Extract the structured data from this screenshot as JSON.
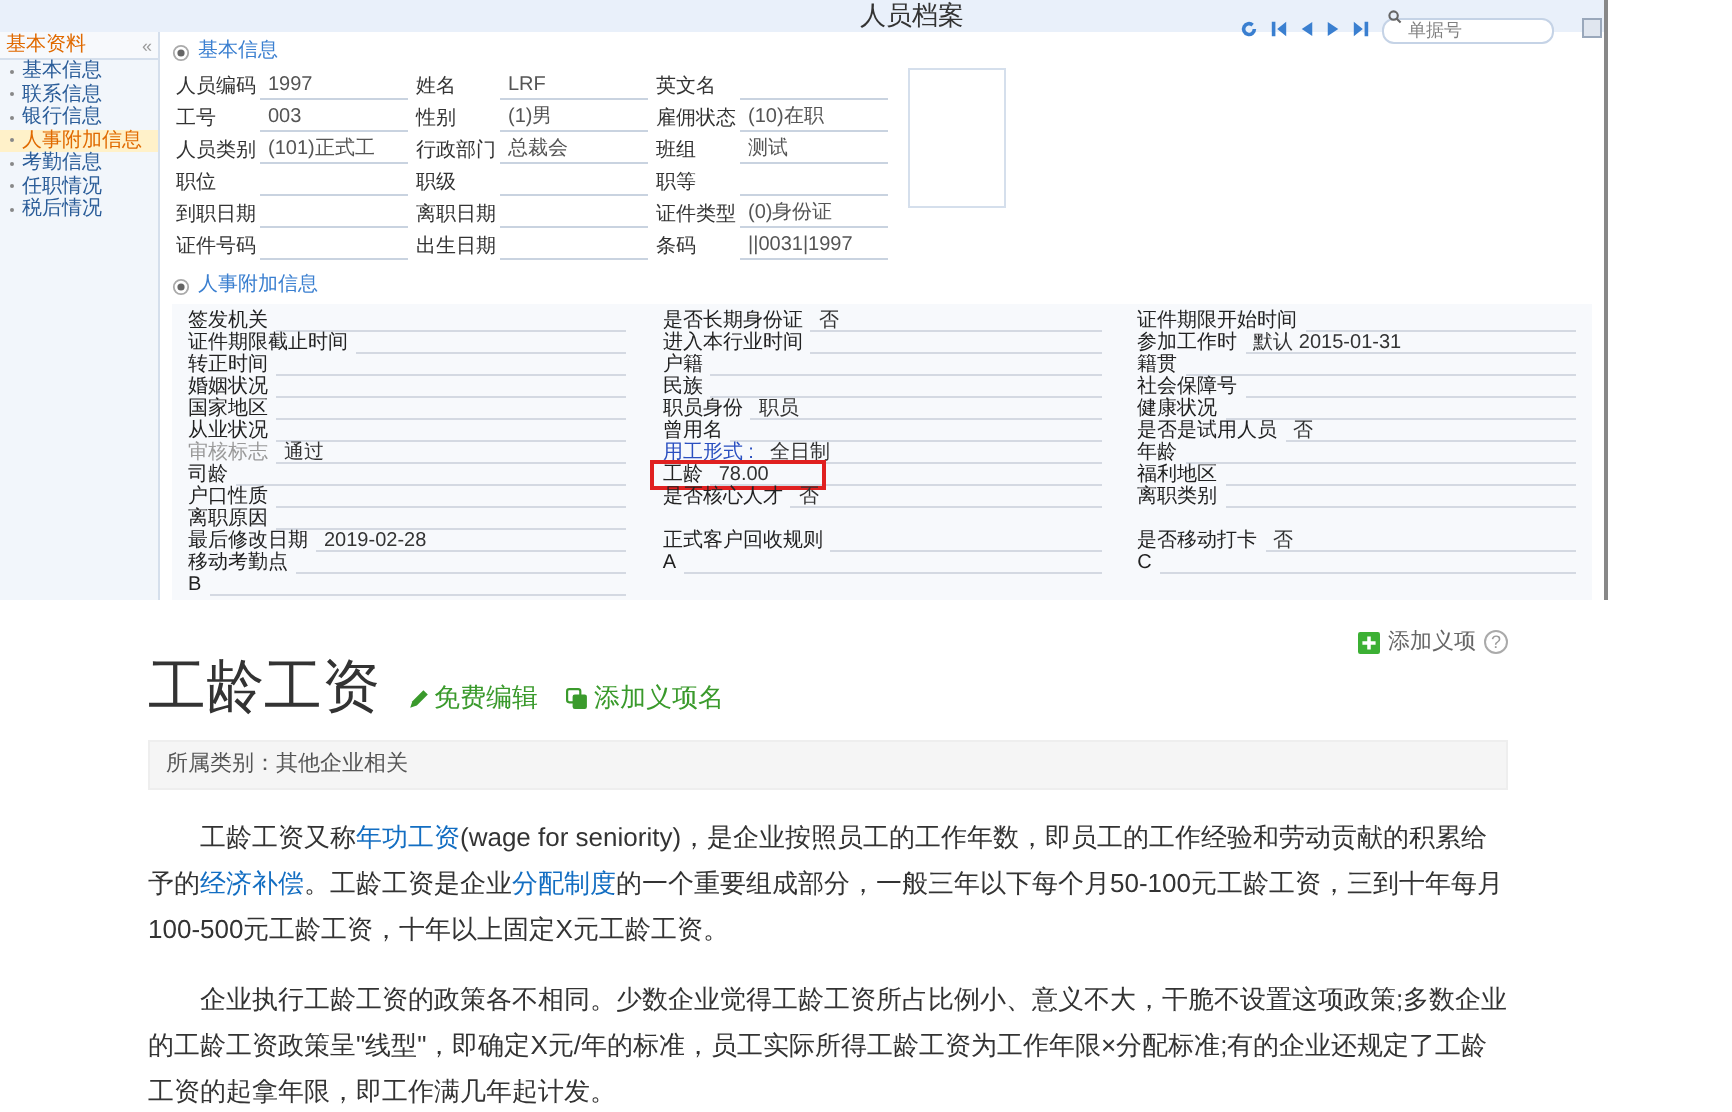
{
  "window": {
    "title": "人员档案"
  },
  "toolbar": {
    "search": {
      "placeholder": "单据号"
    }
  },
  "sidebar": {
    "title": "基本资料",
    "collapse": "«",
    "items": [
      {
        "label": "基本信息",
        "selected": false
      },
      {
        "label": "联系信息",
        "selected": false
      },
      {
        "label": "银行信息",
        "selected": false
      },
      {
        "label": "人事附加信息",
        "selected": true
      },
      {
        "label": "考勤信息",
        "selected": false
      },
      {
        "label": "任职情况",
        "selected": false
      },
      {
        "label": "税后情况",
        "selected": false
      }
    ]
  },
  "basic_info": {
    "title": "基本信息",
    "rows": [
      [
        {
          "label": "人员编码",
          "value": "1997"
        },
        {
          "label": "姓名",
          "value": "LRF"
        },
        {
          "label": "英文名"
        }
      ],
      [
        {
          "label": "工号",
          "value": "003"
        },
        {
          "label": "性别",
          "value": "(1)男"
        },
        {
          "label": "雇佣状态",
          "value": "(10)在职"
        }
      ],
      [
        {
          "label": "人员类别",
          "value": "(101)正式工"
        },
        {
          "label": "行政部门",
          "value": "总裁会"
        },
        {
          "label": "班组",
          "value": "测试"
        }
      ],
      [
        {
          "label": "职位"
        },
        {
          "label": "职级"
        },
        {
          "label": "职等"
        }
      ],
      [
        {
          "label": "到职日期"
        },
        {
          "label": "离职日期"
        },
        {
          "label": "证件类型",
          "value": "(0)身份证"
        }
      ],
      [
        {
          "label": "证件号码"
        },
        {
          "label": "出生日期"
        },
        {
          "label": "条码",
          "value": "||0031|1997"
        }
      ]
    ]
  },
  "extra_info": {
    "title": "人事附加信息",
    "columns": [
      [
        {
          "kind": "normal",
          "label": "签发机关",
          "highlighted": false
        },
        {
          "kind": "normal",
          "label": "证件期限截止时间",
          "highlighted": false
        },
        {
          "kind": "normal",
          "label": "转正时间",
          "highlighted": false
        },
        {
          "kind": "normal",
          "label": "婚姻状况",
          "highlighted": false
        },
        {
          "kind": "normal",
          "label": "国家地区",
          "highlighted": false
        },
        {
          "kind": "normal",
          "label": "从业状况",
          "highlighted": false
        },
        {
          "kind": "muted",
          "label": "审核标志",
          "value": "通过",
          "highlighted": false
        },
        {
          "kind": "normal",
          "label": "司龄",
          "highlighted": false
        },
        {
          "kind": "normal",
          "label": "户口性质",
          "highlighted": false
        },
        {
          "kind": "normal",
          "label": "离职原因",
          "highlighted": false
        },
        {
          "kind": "normal",
          "label": "最后修改日期",
          "value": "2019-02-28",
          "highlighted": false
        },
        {
          "kind": "normal",
          "label": "移动考勤点",
          "highlighted": false
        },
        {
          "kind": "normal",
          "label": "B",
          "highlighted": false
        }
      ],
      [
        {
          "kind": "normal",
          "label": "是否长期身份证",
          "value": "否",
          "highlighted": false
        },
        {
          "kind": "normal",
          "label": "进入本行业时间",
          "highlighted": false
        },
        {
          "kind": "normal",
          "label": "户籍",
          "highlighted": false
        },
        {
          "kind": "normal",
          "label": "民族",
          "highlighted": false
        },
        {
          "kind": "normal",
          "label": "职员身份",
          "value": "职员",
          "highlighted": false
        },
        {
          "kind": "normal",
          "label": "曾用名",
          "highlighted": false
        },
        {
          "kind": "link",
          "label": "用工形式 :",
          "value": "全日制",
          "highlighted": false
        },
        {
          "kind": "normal",
          "label": "工龄",
          "value": "78.00",
          "highlighted": true
        },
        {
          "kind": "normal",
          "label": "是否核心人才",
          "value": "否",
          "highlighted": false
        },
        {
          "kind": "blank"
        },
        {
          "kind": "normal",
          "label": "正式客户回收规则",
          "highlighted": false
        },
        {
          "kind": "normal",
          "label": "A",
          "highlighted": false
        }
      ],
      [
        {
          "kind": "normal",
          "label": "证件期限开始时间",
          "highlighted": false
        },
        {
          "kind": "normal",
          "label": "参加工作时",
          "value": "默认 2015-01-31",
          "highlighted": false
        },
        {
          "kind": "normal",
          "label": "籍贯",
          "highlighted": false
        },
        {
          "kind": "normal",
          "label": "社会保障号",
          "highlighted": false
        },
        {
          "kind": "normal",
          "label": "健康状况",
          "highlighted": false
        },
        {
          "kind": "normal",
          "label": "是否是试用人员",
          "value": "否",
          "highlighted": false
        },
        {
          "kind": "normal",
          "label": "年龄",
          "highlighted": false
        },
        {
          "kind": "normal",
          "label": "福利地区",
          "highlighted": false
        },
        {
          "kind": "normal",
          "label": "离职类别",
          "highlighted": false
        },
        {
          "kind": "blank"
        },
        {
          "kind": "normal",
          "label": "是否移动打卡",
          "value": "否",
          "highlighted": false
        },
        {
          "kind": "normal",
          "label": "C",
          "highlighted": false
        }
      ]
    ]
  },
  "article": {
    "title": "工龄工资",
    "edit_link": "免费编辑",
    "add_name_link": "添加义项名",
    "add_item": "添加义项",
    "help": "?",
    "category": "所属类别：其他企业相关",
    "paragraphs": [
      [
        {
          "text": "工龄工资又称"
        },
        {
          "text": "年功工资",
          "link": true
        },
        {
          "text": "(wage for seniority)，是企业按照员工的工作年数，即员工的工作经验和劳动贡献的积累给予的"
        },
        {
          "text": "经济补偿",
          "link": true
        },
        {
          "text": "。工龄工资是企业"
        },
        {
          "text": "分配制度",
          "link": true
        },
        {
          "text": "的一个重要组成部分，一般三年以下每个月50-100元工龄工资，三到十年每月100-500元工龄工资，十年以上固定X元工龄工资。"
        }
      ],
      [
        {
          "text": "企业执行工龄工资的政策各不相同。少数企业觉得工龄工资所占比例小、意义不大，干脆不设置这项政策;多数企业的工龄工资政策呈\"线型\"，即确定X元/年的标准，员工实际所得工龄工资为工作年限×分配标准;有的企业还规定了工龄工资的起拿年限，即工作满几年起计发。"
        }
      ]
    ]
  }
}
